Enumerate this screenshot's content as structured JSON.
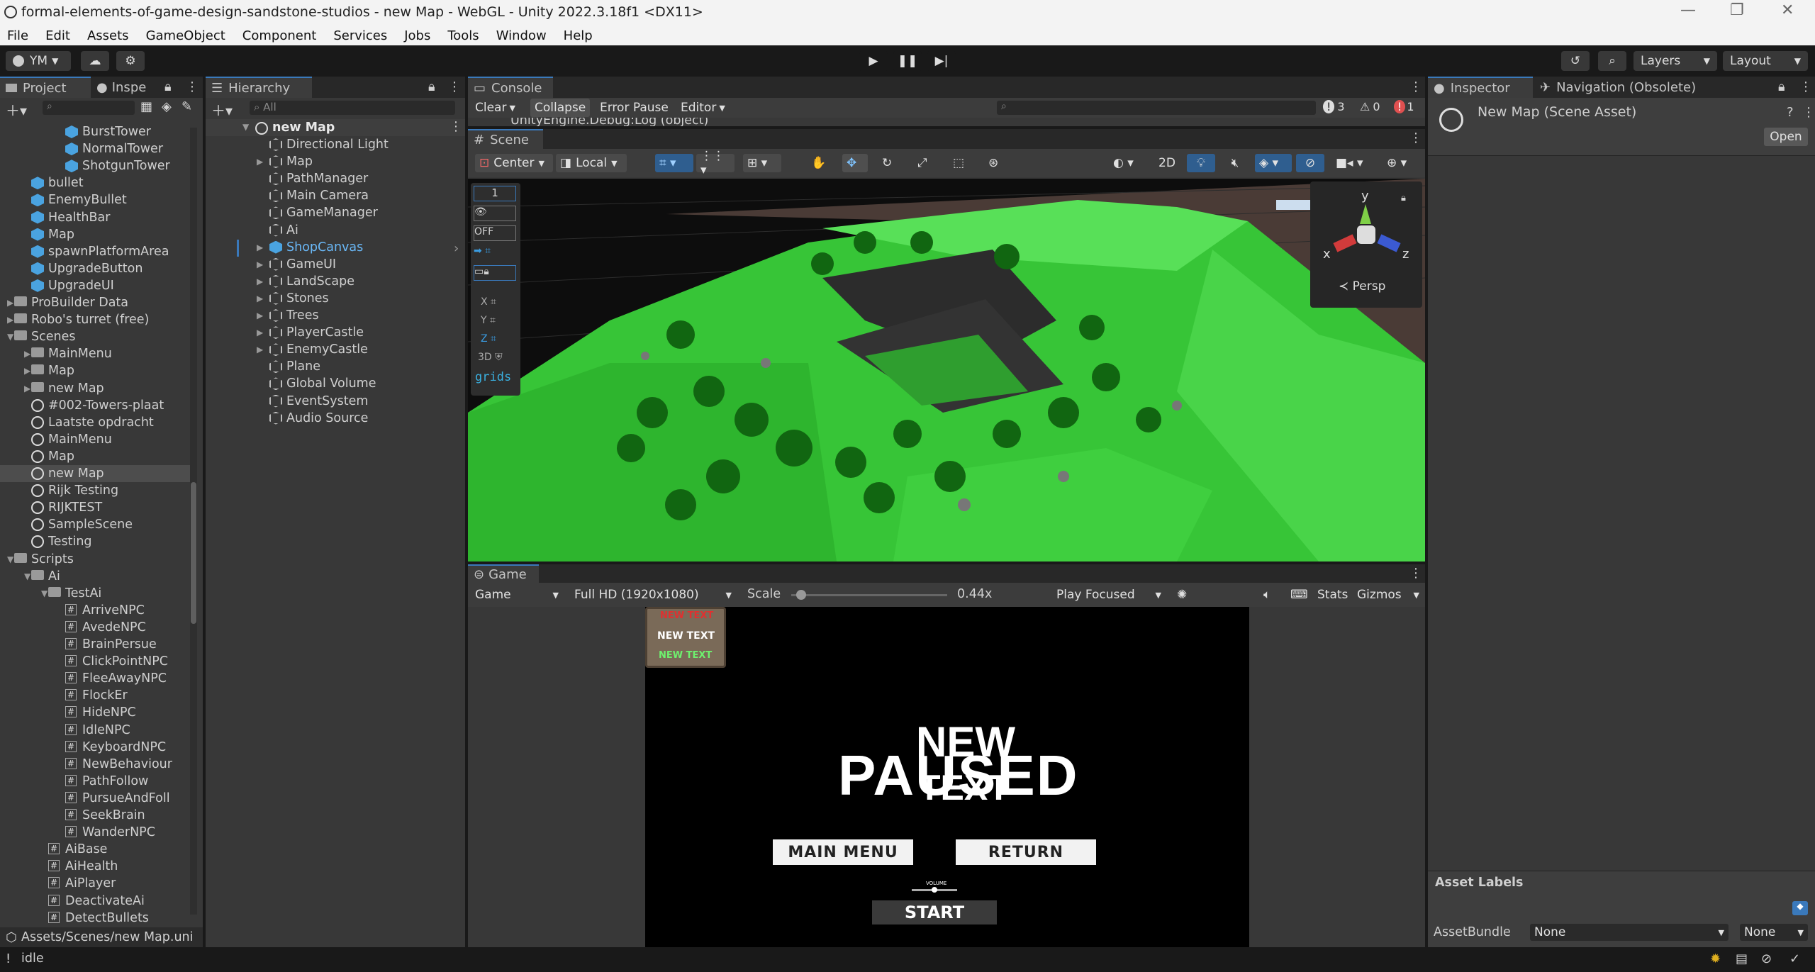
{
  "window": {
    "title": "formal-elements-of-game-design-sandstone-studios - new Map - WebGL - Unity 2022.3.18f1 <DX11>"
  },
  "menu": [
    "File",
    "Edit",
    "Assets",
    "GameObject",
    "Component",
    "Services",
    "Jobs",
    "Tools",
    "Window",
    "Help"
  ],
  "toolbar": {
    "account": "YM",
    "layers": "Layers",
    "layout": "Layout"
  },
  "project": {
    "tab_project": "Project",
    "tab_inspector": "Inspe",
    "items": [
      {
        "label": "BurstTower",
        "icon": "prefab"
      },
      {
        "label": "NormalTower",
        "icon": "prefab"
      },
      {
        "label": "ShotgunTower",
        "icon": "prefab"
      },
      {
        "label": "bullet",
        "icon": "prefab"
      },
      {
        "label": "EnemyBullet",
        "icon": "prefab"
      },
      {
        "label": "HealthBar",
        "icon": "prefab"
      },
      {
        "label": "Map",
        "icon": "prefab"
      },
      {
        "label": "spawnPlatformArea",
        "icon": "prefab"
      },
      {
        "label": "UpgradeButton",
        "icon": "prefab"
      },
      {
        "label": "UpgradeUI",
        "icon": "prefab"
      },
      {
        "label": "ProBuilder Data",
        "icon": "folder"
      },
      {
        "label": "Robo's turret (free)",
        "icon": "folder"
      },
      {
        "label": "Scenes",
        "icon": "folder"
      },
      {
        "label": "MainMenu",
        "icon": "folder"
      },
      {
        "label": "Map",
        "icon": "folder"
      },
      {
        "label": "new Map",
        "icon": "folder"
      },
      {
        "label": "#002-Towers-plaat",
        "icon": "scene"
      },
      {
        "label": "Laatste opdracht",
        "icon": "scene"
      },
      {
        "label": "MainMenu",
        "icon": "scene"
      },
      {
        "label": "Map",
        "icon": "scene"
      },
      {
        "label": "new Map",
        "icon": "scene"
      },
      {
        "label": "Rijk Testing",
        "icon": "scene"
      },
      {
        "label": "RIJKTEST",
        "icon": "scene"
      },
      {
        "label": "SampleScene",
        "icon": "scene"
      },
      {
        "label": "Testing",
        "icon": "scene"
      },
      {
        "label": "Scripts",
        "icon": "folder"
      },
      {
        "label": "Ai",
        "icon": "folder"
      },
      {
        "label": "TestAi",
        "icon": "folder"
      },
      {
        "label": "ArriveNPC",
        "icon": "script"
      },
      {
        "label": "AvedeNPC",
        "icon": "script"
      },
      {
        "label": "BrainPersue",
        "icon": "script"
      },
      {
        "label": "ClickPointNPC",
        "icon": "script"
      },
      {
        "label": "FleeAwayNPC",
        "icon": "script"
      },
      {
        "label": "FlockEr",
        "icon": "script"
      },
      {
        "label": "HideNPC",
        "icon": "script"
      },
      {
        "label": "IdleNPC",
        "icon": "script"
      },
      {
        "label": "KeyboardNPC",
        "icon": "script"
      },
      {
        "label": "NewBehaviour",
        "icon": "script"
      },
      {
        "label": "PathFollow",
        "icon": "script"
      },
      {
        "label": "PursueAndFoll",
        "icon": "script"
      },
      {
        "label": "SeekBrain",
        "icon": "script"
      },
      {
        "label": "WanderNPC",
        "icon": "script"
      },
      {
        "label": "AiBase",
        "icon": "script"
      },
      {
        "label": "AiHealth",
        "icon": "script"
      },
      {
        "label": "AiPlayer",
        "icon": "script"
      },
      {
        "label": "DeactivateAi",
        "icon": "script"
      },
      {
        "label": "DetectBullets",
        "icon": "script"
      }
    ],
    "footer_path": "Assets/Scenes/new Map.uni"
  },
  "hierarchy": {
    "tab": "Hierarchy",
    "search_placeholder": "All",
    "scene": "new Map",
    "items": [
      {
        "label": "Directional Light",
        "expand": false
      },
      {
        "label": "Map",
        "expand": true
      },
      {
        "label": "PathManager",
        "expand": false
      },
      {
        "label": "Main Camera",
        "expand": false
      },
      {
        "label": "GameManager",
        "expand": false
      },
      {
        "label": "Ai",
        "expand": false
      },
      {
        "label": "ShopCanvas",
        "expand": true,
        "blue": true
      },
      {
        "label": "GameUI",
        "expand": true
      },
      {
        "label": "LandScape",
        "expand": true
      },
      {
        "label": "Stones",
        "expand": true
      },
      {
        "label": "Trees",
        "expand": true
      },
      {
        "label": "PlayerCastle",
        "expand": true
      },
      {
        "label": "EnemyCastle",
        "expand": true
      },
      {
        "label": "Plane",
        "expand": false
      },
      {
        "label": "Global Volume",
        "expand": false
      },
      {
        "label": "EventSystem",
        "expand": false
      },
      {
        "label": "Audio Source",
        "expand": false
      }
    ]
  },
  "console": {
    "tab": "Console",
    "clear": "Clear",
    "collapse": "Collapse",
    "error_pause": "Error Pause",
    "editor": "Editor",
    "count_log": "3",
    "count_warn": "0",
    "count_error": "1",
    "log_line": "UnityEngine.Debug:Log (object)"
  },
  "scene": {
    "tab": "Scene",
    "pivot": "Center",
    "space": "Local",
    "mode_2d": "2D",
    "overlay": {
      "speed": "1",
      "off": "OFF",
      "x": "X",
      "y": "Y",
      "z": "Z",
      "threed": "3D",
      "grids": "grids"
    },
    "gizmo": {
      "y": "y",
      "x": "x",
      "z": "z",
      "persp": "Persp"
    }
  },
  "game": {
    "tab": "Game",
    "display": "Game",
    "resolution": "Full HD (1920x1080)",
    "scale_label": "Scale",
    "scale_value": "0.44x",
    "scale_fraction": 0.03,
    "play_mode": "Play Focused",
    "stats": "Stats",
    "gizmos": "Gizmos",
    "screen": {
      "text_red": "NEW TEXT",
      "text_white": "NEW TEXT",
      "text_green": "NEW TEXT",
      "paused": "PAUSED",
      "new_text": "NEW",
      "text_word": "TEXT",
      "main_menu": "MAIN MENU",
      "return": "RETURN",
      "volume": "VOLUME",
      "start": "START"
    }
  },
  "inspector": {
    "tab": "Inspector",
    "tab2": "Navigation (Obsolete)",
    "asset_title": "New Map (Scene Asset)",
    "open": "Open",
    "asset_labels": "Asset Labels",
    "asset_bundle_label": "AssetBundle",
    "bundle_value": "None",
    "variant_value": "None"
  },
  "status": {
    "text": "idle"
  }
}
